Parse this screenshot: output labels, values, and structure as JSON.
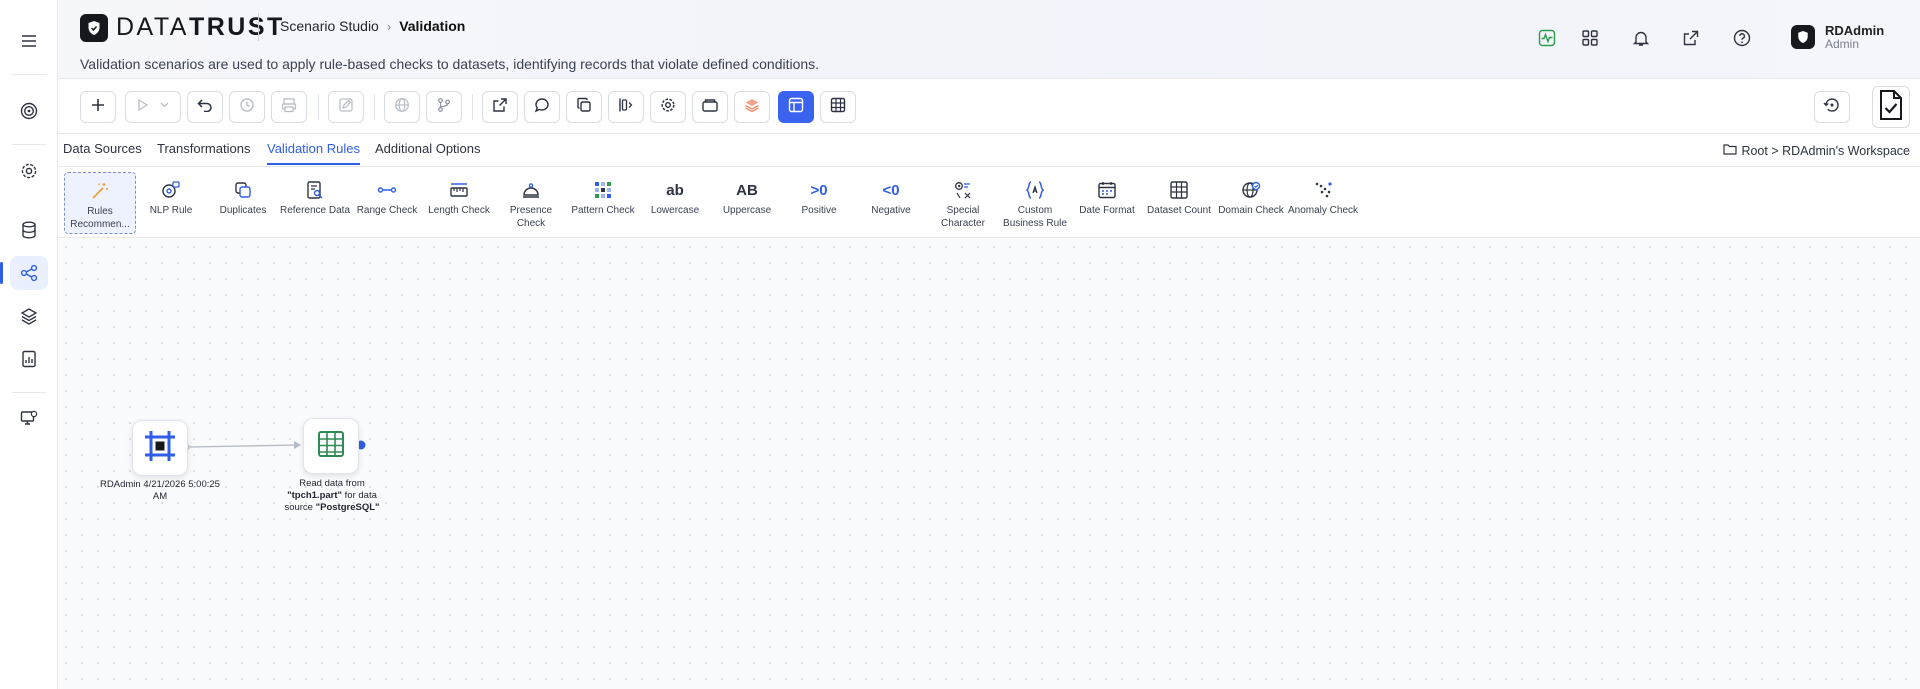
{
  "brand": {
    "name_light": "DATA",
    "name_bold": "TRUST"
  },
  "header": {
    "breadcrumb_parent": "Scenario Studio",
    "breadcrumb_current": "Validation",
    "subtitle": "Validation scenarios are used to apply rule-based checks to datasets, identifying records that violate defined conditions."
  },
  "user": {
    "name": "RDAdmin",
    "role": "Admin"
  },
  "tabs": [
    {
      "label": "Data Sources"
    },
    {
      "label": "Transformations"
    },
    {
      "label": "Validation Rules"
    },
    {
      "label": "Additional Options"
    }
  ],
  "workspace_path": "Root > RDAdmin's Workspace",
  "rules": [
    {
      "label": "Rules Recommen...",
      "icon": "magic-wand-icon"
    },
    {
      "label": "NLP Rule",
      "icon": "nlp-icon"
    },
    {
      "label": "Duplicates",
      "icon": "duplicate-icon"
    },
    {
      "label": "Reference Data",
      "icon": "reference-doc-icon"
    },
    {
      "label": "Range Check",
      "icon": "range-icon"
    },
    {
      "label": "Length Check",
      "icon": "ruler-icon"
    },
    {
      "label": "Presence Check",
      "icon": "bell-presence-icon"
    },
    {
      "label": "Pattern Check",
      "icon": "pattern-grid-icon"
    },
    {
      "label": "Lowercase",
      "icon": "lowercase-icon"
    },
    {
      "label": "Uppercase",
      "icon": "uppercase-icon"
    },
    {
      "label": "Positive",
      "icon": "greater-than-zero-icon"
    },
    {
      "label": "Negative",
      "icon": "less-than-zero-icon"
    },
    {
      "label": "Special Character",
      "icon": "special-char-icon"
    },
    {
      "label": "Custom Business Rule",
      "icon": "braces-icon"
    },
    {
      "label": "Date Format",
      "icon": "calendar-icon"
    },
    {
      "label": "Dataset Count",
      "icon": "table-count-icon"
    },
    {
      "label": "Domain Check",
      "icon": "globe-check-icon"
    },
    {
      "label": "Anomaly Check",
      "icon": "scatter-icon"
    }
  ],
  "rule_glyphs": {
    "lowercase": "ab",
    "uppercase": "AB",
    "positive": ">0",
    "negative": "<0"
  },
  "nodes": {
    "start": {
      "caption": "RDAdmin 4/21/2026 5:00:25 AM"
    },
    "source": {
      "caption_prefix": "Read data from ",
      "table": "\"tpch1.part\"",
      "caption_mid": " for data source ",
      "datasource": "\"PostgreSQL\""
    }
  },
  "colors": {
    "accent": "#2f5fe6",
    "active_button": "#3a63f0",
    "node_icon": "#2e8b57",
    "start_icon": "#2f5fe6"
  }
}
